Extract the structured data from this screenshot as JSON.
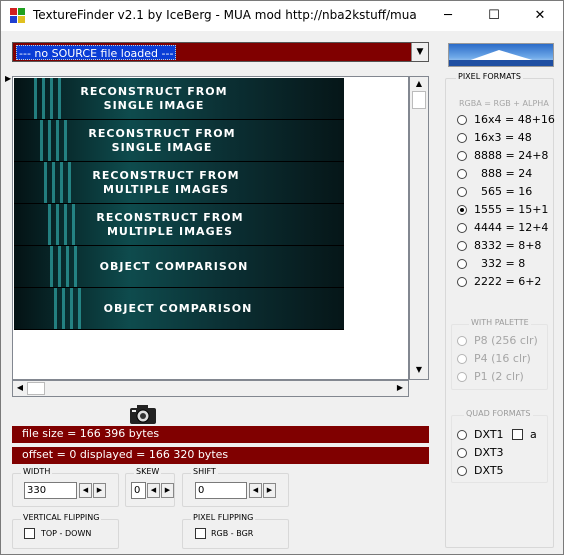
{
  "window": {
    "title": "TextureFinder v2.1 by IceBerg - MUA mod http://nba2kstuff/mua",
    "minimize": "─",
    "maximize": "☐",
    "close": "✕"
  },
  "source_select": {
    "value": "--- no SOURCE file loaded ---"
  },
  "texture_labels": [
    {
      "line1": "RECONSTRUCT FROM",
      "line2": "SINGLE IMAGE"
    },
    {
      "line1": "RECONSTRUCT FROM",
      "line2": "SINGLE IMAGE"
    },
    {
      "line1": "RECONSTRUCT FROM",
      "line2": "MULTIPLE IMAGES"
    },
    {
      "line1": "RECONSTRUCT FROM",
      "line2": "MULTIPLE IMAGES"
    },
    {
      "line1": "OBJECT COMPARISON",
      "line2": ""
    },
    {
      "line1": "OBJECT COMPARISON",
      "line2": ""
    }
  ],
  "info": {
    "file_size": "file size = 166 396 bytes",
    "offset_line": "offset = 0   displayed = 166 320 bytes"
  },
  "width": {
    "label": "WIDTH",
    "value": "330"
  },
  "skew": {
    "label": "SKEW",
    "value": "0"
  },
  "shift": {
    "label": "SHIFT",
    "value": "0"
  },
  "vertical_flipping": {
    "label": "VERTICAL FLIPPING",
    "option": "TOP - DOWN"
  },
  "pixel_flipping": {
    "label": "PIXEL FLIPPING",
    "option": "RGB  -  BGR"
  },
  "pixel_formats": {
    "label": "PIXEL FORMATS",
    "sub_label": "RGBA = RGB + ALPHA",
    "options": [
      "16x4 = 48+16",
      "16x3 = 48",
      "8888 = 24+8",
      "  888 = 24",
      "  565 = 16",
      "1555 = 15+1",
      "4444 = 12+4",
      "8332 = 8+8",
      "  332 = 8",
      "2222 = 6+2"
    ],
    "selected": "1555 = 15+1"
  },
  "with_palette": {
    "label": "WITH PALETTE",
    "options": [
      "P8  (256 clr)",
      "P4  (16 clr)",
      "P1  (2 clr)"
    ]
  },
  "quad_formats": {
    "label": "QUAD FORMATS",
    "options": [
      "DXT1",
      "DXT3",
      "DXT5"
    ],
    "alpha_checkbox": "a"
  },
  "icons": {
    "app": "app-icon",
    "camera": "camera-icon",
    "logo": "iceberg-logo"
  },
  "colors": {
    "info_bar": "#800000",
    "selection": "#0a3dd6"
  }
}
